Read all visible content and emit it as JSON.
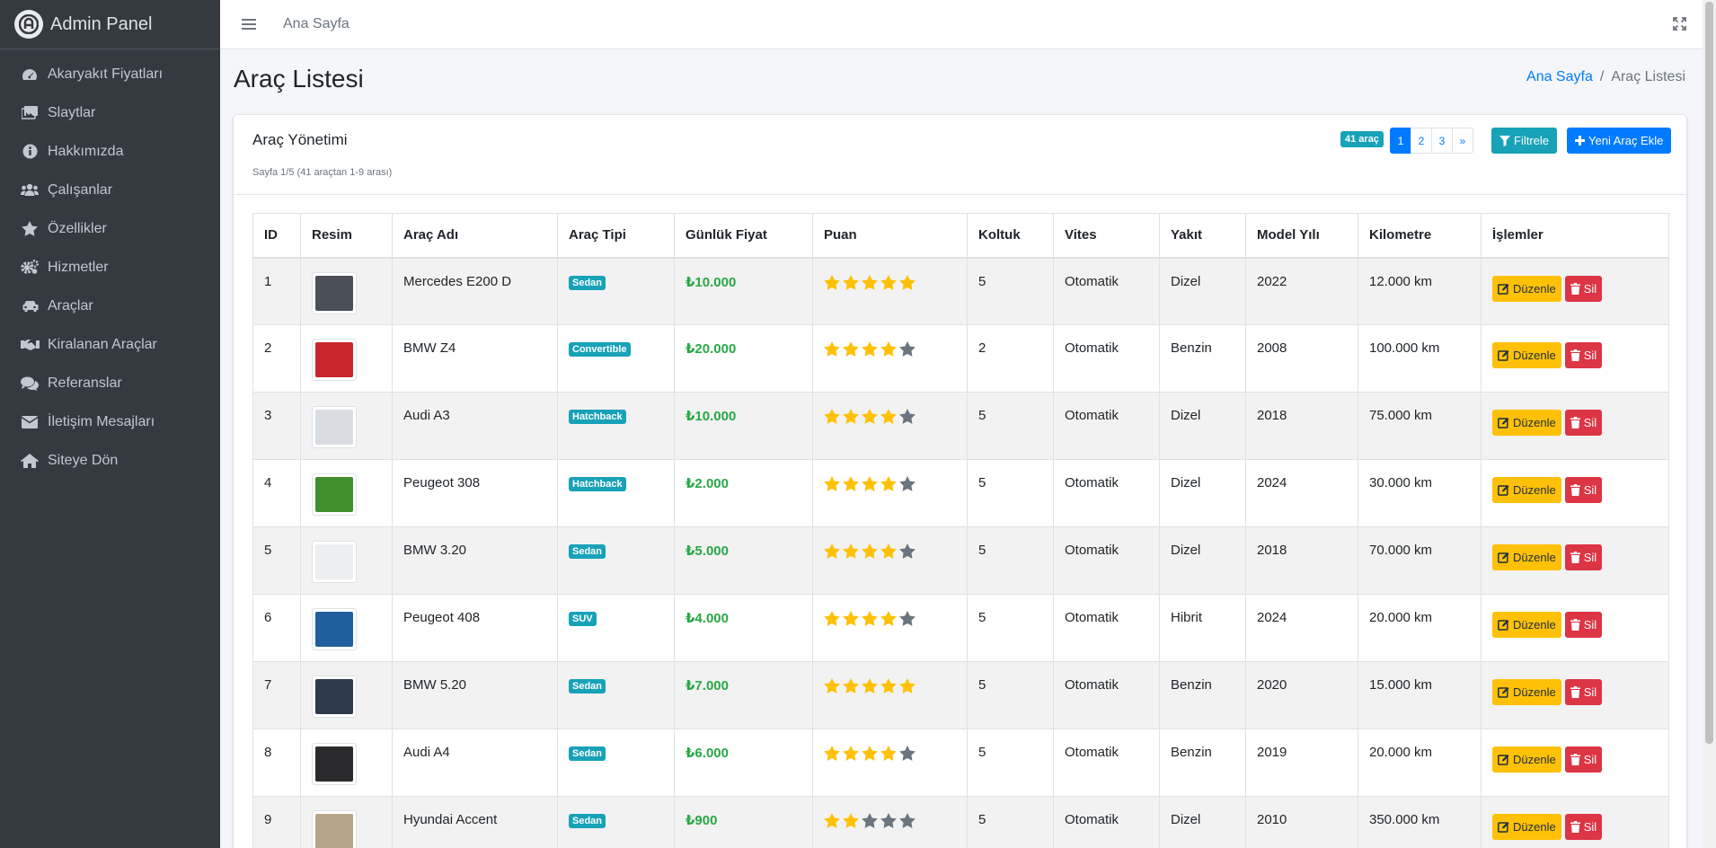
{
  "sidebar": {
    "brand": "Admin Panel",
    "items": [
      {
        "label": "Akaryakıt Fiyatları",
        "icon": "tachometer-icon"
      },
      {
        "label": "Slaytlar",
        "icon": "images-icon"
      },
      {
        "label": "Hakkımızda",
        "icon": "info-circle-icon"
      },
      {
        "label": "Çalışanlar",
        "icon": "users-icon"
      },
      {
        "label": "Özellikler",
        "icon": "star-icon"
      },
      {
        "label": "Hizmetler",
        "icon": "cogs-icon"
      },
      {
        "label": "Araçlar",
        "icon": "car-icon"
      },
      {
        "label": "Kiralanan Araçlar",
        "icon": "handshake-icon"
      },
      {
        "label": "Referanslar",
        "icon": "comments-icon"
      },
      {
        "label": "İletişim Mesajları",
        "icon": "envelope-icon"
      },
      {
        "label": "Siteye Dön",
        "icon": "home-icon"
      }
    ]
  },
  "topbar": {
    "home_link": "Ana Sayfa"
  },
  "page": {
    "title": "Araç Listesi"
  },
  "breadcrumb": {
    "home": "Ana Sayfa",
    "sep": "/",
    "current": "Araç Listesi"
  },
  "card": {
    "title": "Araç Yönetimi",
    "subtitle": "Sayfa 1/5 (41 araçtan 1-9 arası)",
    "count_badge": "41 araç",
    "pages": [
      "1",
      "2",
      "3",
      "»"
    ],
    "filter_label": "Filtrele",
    "add_label": "Yeni Araç Ekle"
  },
  "table": {
    "headers": [
      "ID",
      "Resim",
      "Araç Adı",
      "Araç Tipi",
      "Günlük Fiyat",
      "Puan",
      "Koltuk",
      "Vites",
      "Yakıt",
      "Model Yılı",
      "Kilometre",
      "İşlemler"
    ],
    "edit_label": "Düzenle",
    "delete_label": "Sil",
    "rows": [
      {
        "id": "1",
        "name": "Mercedes E200 D",
        "type": "Sedan",
        "price": "₺10.000",
        "rating": 5,
        "seats": "5",
        "gear": "Otomatik",
        "fuel": "Dizel",
        "year": "2022",
        "km": "12.000 km",
        "img_color": "#4a4f58"
      },
      {
        "id": "2",
        "name": "BMW Z4",
        "type": "Convertible",
        "price": "₺20.000",
        "rating": 4,
        "seats": "2",
        "gear": "Otomatik",
        "fuel": "Benzin",
        "year": "2008",
        "km": "100.000 km",
        "img_color": "#c8262c"
      },
      {
        "id": "3",
        "name": "Audi A3",
        "type": "Hatchback",
        "price": "₺10.000",
        "rating": 4,
        "seats": "5",
        "gear": "Otomatik",
        "fuel": "Dizel",
        "year": "2018",
        "km": "75.000 km",
        "img_color": "#d9dde2"
      },
      {
        "id": "4",
        "name": "Peugeot 308",
        "type": "Hatchback",
        "price": "₺2.000",
        "rating": 4,
        "seats": "5",
        "gear": "Otomatik",
        "fuel": "Dizel",
        "year": "2024",
        "km": "30.000 km",
        "img_color": "#3f8f2e"
      },
      {
        "id": "5",
        "name": "BMW 3.20",
        "type": "Sedan",
        "price": "₺5.000",
        "rating": 4,
        "seats": "5",
        "gear": "Otomatik",
        "fuel": "Dizel",
        "year": "2018",
        "km": "70.000 km",
        "img_color": "#eceef0"
      },
      {
        "id": "6",
        "name": "Peugeot 408",
        "type": "SUV",
        "price": "₺4.000",
        "rating": 4,
        "seats": "5",
        "gear": "Otomatik",
        "fuel": "Hibrit",
        "year": "2024",
        "km": "20.000 km",
        "img_color": "#1f5f9e"
      },
      {
        "id": "7",
        "name": "BMW 5.20",
        "type": "Sedan",
        "price": "₺7.000",
        "rating": 5,
        "seats": "5",
        "gear": "Otomatik",
        "fuel": "Benzin",
        "year": "2020",
        "km": "15.000 km",
        "img_color": "#2d3a4a"
      },
      {
        "id": "8",
        "name": "Audi A4",
        "type": "Sedan",
        "price": "₺6.000",
        "rating": 4,
        "seats": "5",
        "gear": "Otomatik",
        "fuel": "Benzin",
        "year": "2019",
        "km": "20.000 km",
        "img_color": "#2b2b2e"
      },
      {
        "id": "9",
        "name": "Hyundai Accent",
        "type": "Sedan",
        "price": "₺900",
        "rating": 2,
        "seats": "5",
        "gear": "Otomatik",
        "fuel": "Dizel",
        "year": "2010",
        "km": "350.000 km",
        "img_color": "#b8a48a"
      }
    ]
  },
  "colors": {
    "sidebar": "#343a40",
    "primary": "#007bff",
    "info": "#17a2b8",
    "success": "#28a745",
    "warning": "#ffc107",
    "danger": "#dc3545",
    "star_on": "#ffc107",
    "star_off": "#6c757d"
  }
}
